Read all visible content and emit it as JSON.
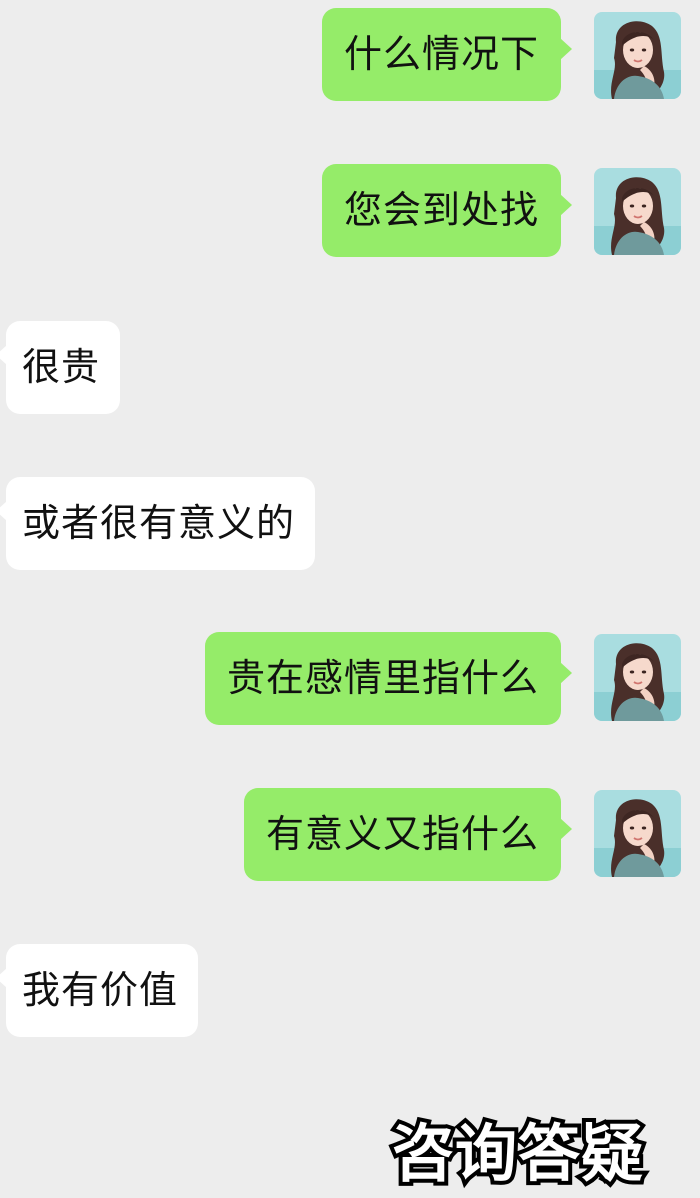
{
  "conversation": {
    "messages": [
      {
        "direction": "outgoing",
        "text": "什么情况下"
      },
      {
        "direction": "outgoing",
        "text": "您会到处找"
      },
      {
        "direction": "incoming",
        "text": "很贵"
      },
      {
        "direction": "incoming",
        "text": "或者很有意义的"
      },
      {
        "direction": "outgoing",
        "text": "贵在感情里指什么"
      },
      {
        "direction": "outgoing",
        "text": "有意义又指什么"
      },
      {
        "direction": "incoming",
        "text": "我有价值"
      }
    ]
  },
  "overlay": {
    "caption": "咨询答疑"
  },
  "colors": {
    "background": "#ededed",
    "outgoing_bubble": "#95ec69",
    "incoming_bubble": "#ffffff",
    "text": "#111111"
  },
  "icons": {
    "avatar": "user-avatar-portrait"
  }
}
